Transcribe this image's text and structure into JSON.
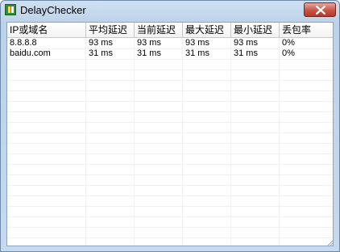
{
  "window": {
    "title": "DelayChecker",
    "app_icon": "app-icon",
    "close_icon": "close-icon"
  },
  "table": {
    "columns": [
      "IP或域名",
      "平均延迟",
      "当前延迟",
      "最大延迟",
      "最小延迟",
      "丢包率"
    ],
    "rows": [
      [
        "8.8.8.8",
        "93 ms",
        "93 ms",
        "93 ms",
        "93 ms",
        "0%"
      ],
      [
        "baidu.com",
        "31 ms",
        "31 ms",
        "31 ms",
        "31 ms",
        "0%"
      ]
    ]
  },
  "colors": {
    "titlebar": "#c6d9ee",
    "close_button": "#c75547",
    "grid": "#f0f0f0"
  }
}
